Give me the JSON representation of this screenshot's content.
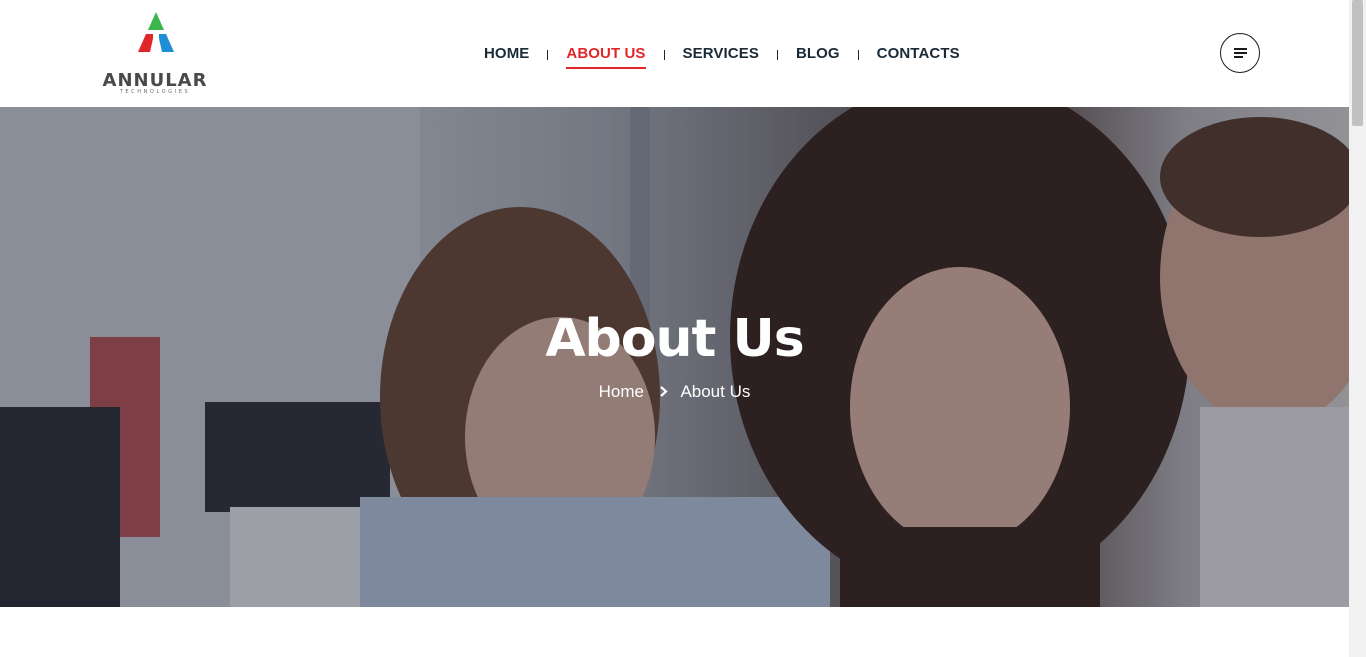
{
  "header": {
    "logo": {
      "word": "ANNULAR",
      "sub": "TECHNOLOGIES"
    },
    "nav": [
      {
        "label": "HOME",
        "active": false
      },
      {
        "label": "ABOUT US",
        "active": true
      },
      {
        "label": "SERVICES",
        "active": false
      },
      {
        "label": "BLOG",
        "active": false
      },
      {
        "label": "CONTACTS",
        "active": false
      }
    ],
    "menu_icon": "hamburger-icon"
  },
  "hero": {
    "title": "About Us",
    "breadcrumb": {
      "home": "Home",
      "separator_icon": "chevron-right-icon",
      "current": "About Us"
    }
  },
  "colors": {
    "accent": "#e0262b",
    "nav_text": "#1a2a36",
    "hero_text": "#ffffff"
  }
}
